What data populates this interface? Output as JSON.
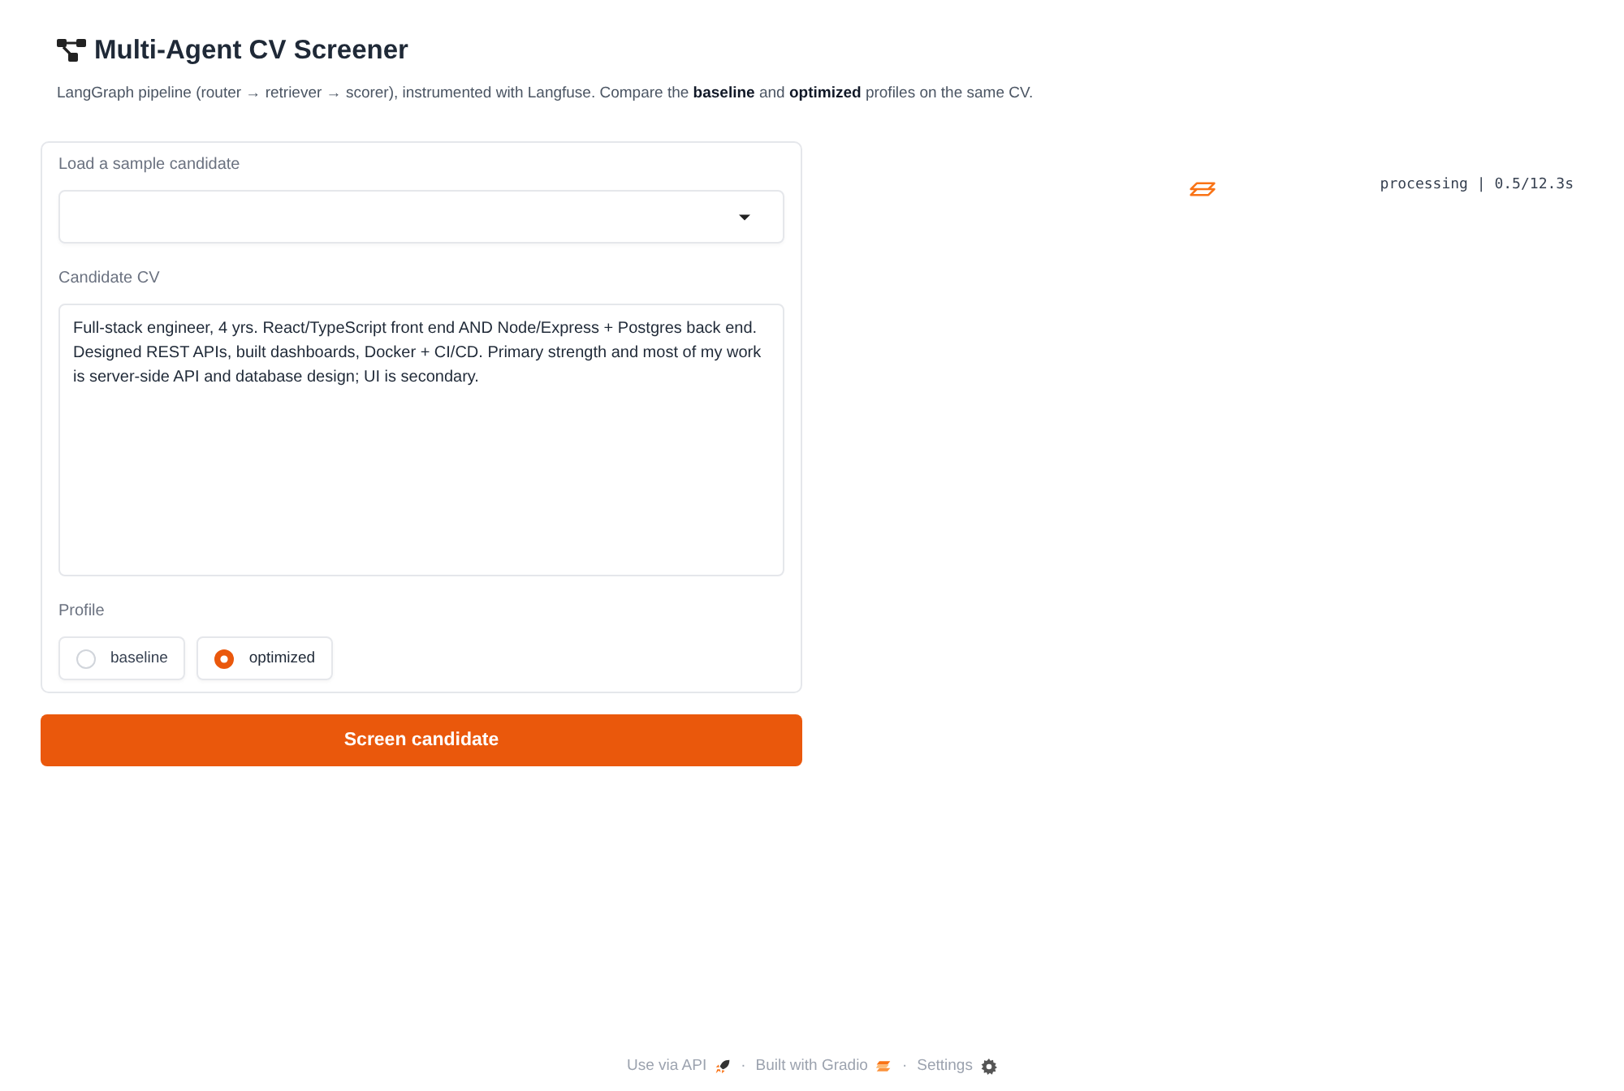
{
  "header": {
    "title": "Multi-Agent CV Screener",
    "description": "LangGraph pipeline (router → retriever → scorer), instrumented with Langfuse. Compare the **baseline** and **optimized** profiles on the same CV."
  },
  "form": {
    "sample_dropdown": {
      "label": "Load a sample candidate"
    },
    "cv": {
      "label": "Candidate CV",
      "value": "Full-stack engineer, 4 yrs. React/TypeScript front end AND Node/Express + Postgres back end. Designed REST APIs, built dashboards, Docker + CI/CD. Primary strength and most of my work is server-side API and database design; UI is secondary."
    },
    "profile": {
      "label": "Profile",
      "options": [
        {
          "label": "baseline",
          "selected": false
        },
        {
          "label": "optimized",
          "selected": true
        }
      ]
    }
  },
  "submit_button": {
    "label": "Screen candidate"
  },
  "output": {
    "status": "processing | 0.5/12.3s"
  },
  "footer": {
    "items": [
      {
        "kind": "api",
        "label": "Use via API"
      },
      {
        "kind": "gradio",
        "label": "Built with Gradio"
      },
      {
        "kind": "settings",
        "label": "Settings"
      }
    ],
    "separators": [
      "·",
      "·"
    ]
  }
}
